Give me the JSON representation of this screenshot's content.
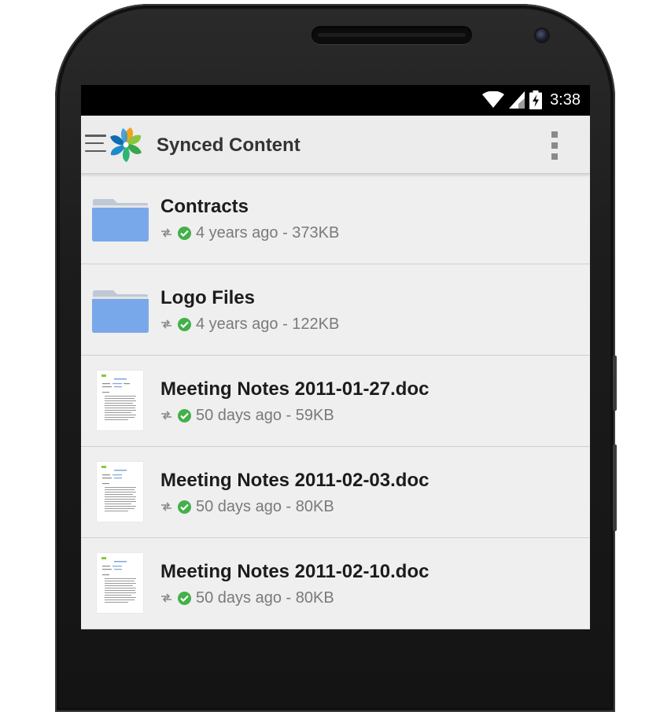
{
  "status_bar": {
    "time": "3:38",
    "icons": [
      "wifi-icon",
      "signal-icon",
      "battery-charging-icon"
    ]
  },
  "app_bar": {
    "title": "Synced Content",
    "nav_icon": "hamburger-menu-icon",
    "logo_icon": "alfresco-flower-logo",
    "overflow_icon": "overflow-menu-icon"
  },
  "colors": {
    "app_bar_bg": "#ececec",
    "list_bg": "#efefef",
    "folder": "#79a8ea",
    "synced_check": "#43b049",
    "meta_text": "#7a7a7a"
  },
  "items": [
    {
      "type": "folder",
      "name": "Contracts",
      "age": "4 years ago",
      "size": "373KB",
      "meta": "4 years ago - 373KB"
    },
    {
      "type": "folder",
      "name": "Logo Files",
      "age": "4 years ago",
      "size": "122KB",
      "meta": "4 years ago - 122KB"
    },
    {
      "type": "document",
      "name": "Meeting Notes 2011-01-27.doc",
      "age": "50 days ago",
      "size": "59KB",
      "meta": "50 days ago - 59KB"
    },
    {
      "type": "document",
      "name": "Meeting Notes 2011-02-03.doc",
      "age": "50 days ago",
      "size": "80KB",
      "meta": "50 days ago - 80KB"
    },
    {
      "type": "document",
      "name": "Meeting Notes 2011-02-10.doc",
      "age": "50 days ago",
      "size": "80KB",
      "meta": "50 days ago - 80KB"
    }
  ]
}
